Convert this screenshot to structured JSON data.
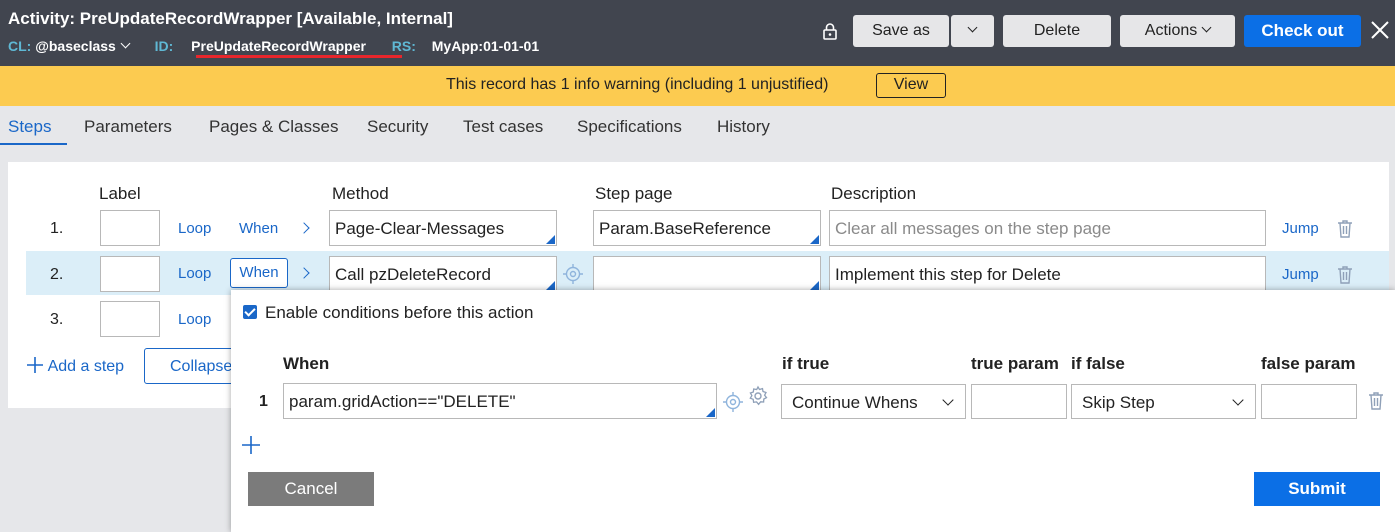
{
  "header": {
    "title": "Activity: PreUpdateRecordWrapper [Available, Internal]",
    "cl_key": "CL:",
    "cl_value": "@baseclass",
    "id_key": "ID:",
    "id_value": "PreUpdateRecordWrapper",
    "rs_key": "RS:",
    "rs_value": "MyApp:01-01-01",
    "save_as_label": "Save as",
    "delete_label": "Delete",
    "actions_label": "Actions",
    "checkout_label": "Check out"
  },
  "warning": {
    "text": "This record has 1 info warning (including 1 unjustified)",
    "view_label": "View"
  },
  "tabs": [
    {
      "label": "Steps"
    },
    {
      "label": "Parameters"
    },
    {
      "label": "Pages & Classes"
    },
    {
      "label": "Security"
    },
    {
      "label": "Test cases"
    },
    {
      "label": "Specifications"
    },
    {
      "label": "History"
    }
  ],
  "steps_table": {
    "headers": {
      "label": "Label",
      "method": "Method",
      "step_page": "Step page",
      "description": "Description"
    },
    "loop_label": "Loop",
    "when_label": "When",
    "jump_label": "Jump",
    "rows": [
      {
        "num": "1.",
        "method": "Page-Clear-Messages",
        "step_page": "Param.BaseReference",
        "description": "Clear all messages on the step page"
      },
      {
        "num": "2.",
        "method": "Call pzDeleteRecord",
        "step_page": "",
        "description": "Implement this step for Delete"
      },
      {
        "num": "3."
      }
    ],
    "add_step_label": "Add a step",
    "collapse_label": "Collapse"
  },
  "when_popover": {
    "enable_label": "Enable conditions before this action",
    "enabled": true,
    "headers": {
      "when": "When",
      "if_true": "if true",
      "true_param": "true param",
      "if_false": "if false",
      "false_param": "false param"
    },
    "conditions": [
      {
        "num": "1",
        "when": "param.gridAction==\"DELETE\"",
        "if_true": "Continue Whens",
        "true_param": "",
        "if_false": "Skip Step",
        "false_param": ""
      }
    ],
    "cancel_label": "Cancel",
    "submit_label": "Submit"
  }
}
